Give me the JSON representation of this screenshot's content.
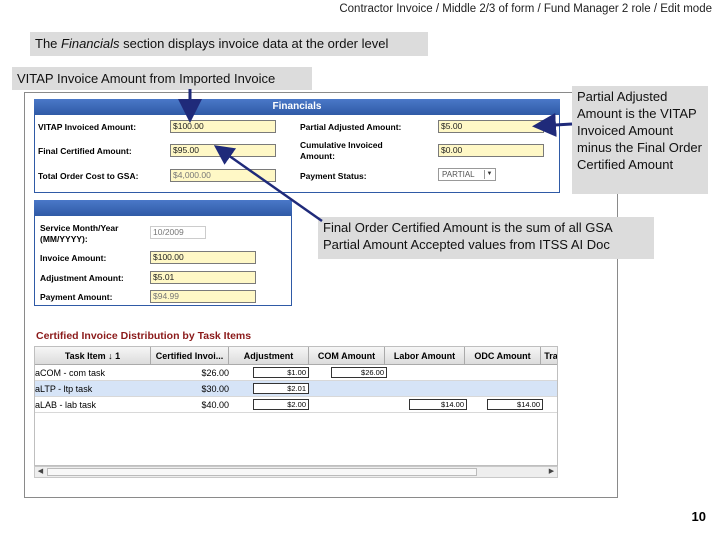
{
  "breadcrumb": "Contractor Invoice / Middle 2/3 of form / Fund Manager 2 role / Edit mode",
  "callouts": {
    "financials_prefix": "The ",
    "financials_em": "Financials",
    "financials_suffix": " section displays invoice data at the order level",
    "vitap": "VITAP Invoice Amount from Imported Invoice",
    "partial": "Partial Adjusted Amount is the VITAP Invoiced Amount minus the Final Order Certified Amount",
    "final": "Final Order Certified Amount is the sum of all GSA Partial Amount Accepted values from ITSS AI Doc"
  },
  "financials": {
    "title": "Financials",
    "vitap_label": "VITAP Invoiced Amount:",
    "vitap_value": "$100.00",
    "final_certified_label": "Final Certified Amount:",
    "final_certified_value": "$95.00",
    "total_order_label": "Total Order Cost to GSA:",
    "total_order_value": "$4,000.00",
    "partial_adjusted_label": "Partial Adjusted Amount:",
    "partial_adjusted_value": "$5.00",
    "cumulative_label_1": "Cumulative Invoiced",
    "cumulative_label_2": "Amount:",
    "cumulative_value": "$0.00",
    "payment_status_label": "Payment Status:",
    "payment_status_value": "PARTIAL"
  },
  "service": {
    "service_month_label_1": "Service Month/Year",
    "service_month_label_2": "(MM/YYYY):",
    "service_month_value": "10/2009",
    "invoice_amount_label": "Invoice Amount:",
    "invoice_amount_value": "$100.00",
    "adjustment_amount_label": "Adjustment Amount:",
    "adjustment_amount_value": "$5.01",
    "payment_amount_label": "Payment Amount:",
    "payment_amount_value": "$94.99"
  },
  "distribution": {
    "title": "Certified Invoice Distribution by Task Items",
    "columns": [
      "Task Item ↓ 1",
      "Certified Invoi...",
      "Adjustment",
      "COM Amount",
      "Labor Amount",
      "ODC Amount",
      "Tra"
    ],
    "rows": [
      {
        "task": "aCOM - com task",
        "certified": "$26.00",
        "adjustment": "$1.00",
        "com": "$26.00",
        "labor": "",
        "odc": ""
      },
      {
        "task": "aLTP - ltp task",
        "certified": "$30.00",
        "adjustment": "$2.01",
        "com": "",
        "labor": "",
        "odc": ""
      },
      {
        "task": "aLAB - lab task",
        "certified": "$40.00",
        "adjustment": "$2.00",
        "com": "",
        "labor": "$14.00",
        "odc": "$14.00"
      }
    ]
  },
  "page_number": "10",
  "colors": {
    "header_blue": "#2f5aa6",
    "field_yellow": "#fff8c6",
    "callout_grey": "#dcdcdc",
    "section_title_red": "#8b1a1a",
    "arrow_navy": "#1f2a7a"
  }
}
